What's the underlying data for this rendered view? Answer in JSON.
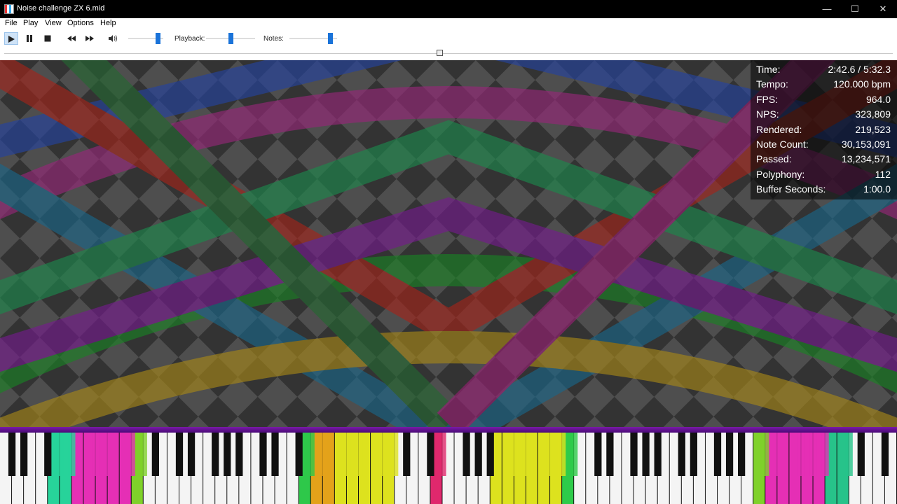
{
  "window": {
    "title": "Noise challenge ZX 6.mid",
    "controls": {
      "minimize": "—",
      "maximize": "☐",
      "close": "✕"
    }
  },
  "menu": [
    "File",
    "Play",
    "View",
    "Options",
    "Help"
  ],
  "toolbar": {
    "buttons": [
      "play-icon",
      "pause-icon",
      "stop-icon",
      "rewind-icon",
      "fast-forward-icon",
      "volume-icon"
    ],
    "playback_label": "Playback:",
    "notes_label": "Notes:",
    "volume_level": 0.9,
    "playback_level": 0.5,
    "notes_level": 0.9
  },
  "seek": {
    "progress": 0.49
  },
  "stats": [
    {
      "label": "Time:",
      "value": "2:42.6 / 5:32.3"
    },
    {
      "label": "Tempo:",
      "value": "120.000 bpm"
    },
    {
      "label": "FPS:",
      "value": "964.0"
    },
    {
      "label": "NPS:",
      "value": "323,809"
    },
    {
      "label": "Rendered:",
      "value": "219,523"
    },
    {
      "label": "Note Count:",
      "value": "30,153,091"
    },
    {
      "label": "Passed:",
      "value": "13,234,571"
    },
    {
      "label": "Polyphony:",
      "value": "112"
    },
    {
      "label": "Buffer Seconds:",
      "value": "1:00.0"
    }
  ],
  "colors": {
    "accent": "#1a73d9",
    "keyboard_bar": "#7a1aa8"
  }
}
